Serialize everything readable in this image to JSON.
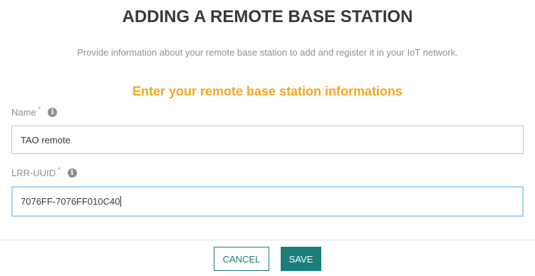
{
  "page": {
    "title": "ADDING A REMOTE BASE STATION",
    "subtitle": "Provide information about your remote base station to add and register it in your IoT network.",
    "section_title": "Enter your remote base station informations"
  },
  "form": {
    "name": {
      "label": "Name",
      "required_mark": "*",
      "value": "TAO remote"
    },
    "lrr_uuid": {
      "label": "LRR-UUID",
      "required_mark": "*",
      "value": "7076FF-7076FF010C40"
    },
    "info_icon_glyph": "i"
  },
  "actions": {
    "cancel_label": "CANCEL",
    "save_label": "SAVE"
  },
  "colors": {
    "accent": "#f5a623",
    "primary": "#1a7f7a",
    "focus": "#a9d6ec"
  },
  "icons": [
    "info-icon"
  ]
}
